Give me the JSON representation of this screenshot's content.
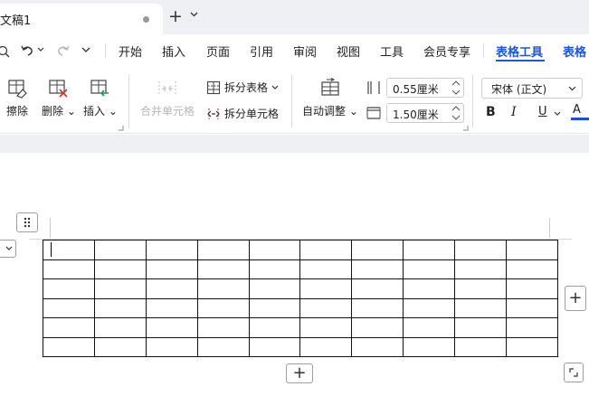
{
  "tabbar": {
    "doc_title": "文稿1"
  },
  "menu": {
    "items": [
      "开始",
      "插入",
      "页面",
      "引用",
      "审阅",
      "视图",
      "工具",
      "会员专享"
    ],
    "active": "表格工具",
    "next": "表格"
  },
  "ribbon": {
    "erase": "擦除",
    "delete": "删除",
    "insert": "插入",
    "merge_cells": "合并单元格",
    "split_table": "拆分表格",
    "split_cells": "拆分单元格",
    "auto_adjust": "自动调整",
    "col_width": "0.55厘米",
    "row_height": "1.50厘米",
    "font_name": "宋体 (正文)",
    "bold": "B",
    "italic": "I",
    "underline": "U",
    "font_color": "A"
  },
  "colors": {
    "accent": "#1a56d6",
    "font_color_bar": "#1a4fd6",
    "delete_red": "#d9342b",
    "insert_green": "#1f9d55"
  },
  "table": {
    "rows": 6,
    "cols": 10
  }
}
